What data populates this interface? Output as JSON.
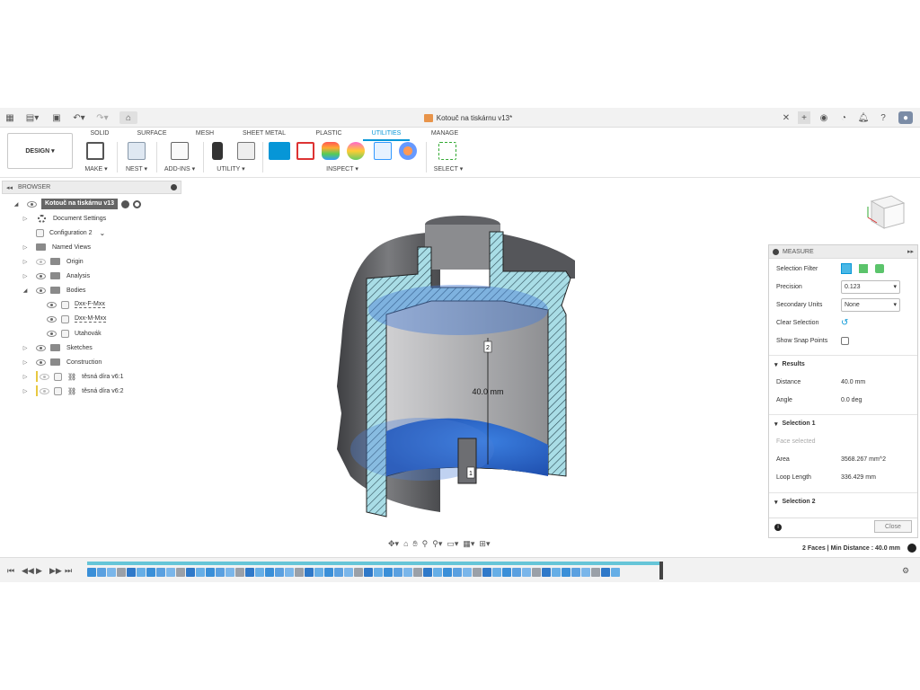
{
  "document": {
    "title": "Kotouč na tiskárnu v13*"
  },
  "ribbon": {
    "design_label": "DESIGN ▾",
    "tabs": [
      {
        "label": "SOLID",
        "active": false
      },
      {
        "label": "SURFACE",
        "active": false
      },
      {
        "label": "MESH",
        "active": false
      },
      {
        "label": "SHEET METAL",
        "active": false
      },
      {
        "label": "PLASTIC",
        "active": false
      },
      {
        "label": "UTILITIES",
        "active": true
      },
      {
        "label": "MANAGE",
        "active": false
      }
    ],
    "groups": {
      "make": "MAKE ▾",
      "nest": "NEST ▾",
      "addins": "ADD-INS ▾",
      "utility": "UTILITY ▾",
      "inspect": "INSPECT ▾",
      "select": "SELECT ▾"
    }
  },
  "browser": {
    "header": "BROWSER",
    "root": "Kotouč na tiskárnu v13",
    "items": [
      {
        "label": "Document Settings"
      },
      {
        "label": "Configuration 2"
      },
      {
        "label": "Named Views"
      },
      {
        "label": "Origin"
      },
      {
        "label": "Analysis"
      },
      {
        "label": "Bodies"
      },
      {
        "label": "Dxx-F-Mxx"
      },
      {
        "label": "Dxx-M-Mxx"
      },
      {
        "label": "Utahovák"
      },
      {
        "label": "Sketches"
      },
      {
        "label": "Construction"
      },
      {
        "label": "těsná díra v6:1"
      },
      {
        "label": "těsná díra v6:2"
      }
    ]
  },
  "viewport": {
    "dimension_label": "40.0 mm",
    "point_1": "1",
    "point_2": "2"
  },
  "measure": {
    "header": "MEASURE",
    "selection_filter": "Selection Filter",
    "precision_label": "Precision",
    "precision_value": "0.123",
    "secondary_units_label": "Secondary Units",
    "secondary_units_value": "None",
    "clear_selection": "Clear Selection",
    "show_snap_points": "Show Snap Points",
    "results_title": "Results",
    "distance_label": "Distance",
    "distance_value": "40.0 mm",
    "angle_label": "Angle",
    "angle_value": "0.0 deg",
    "selection1_title": "Selection 1",
    "face_selected": "Face selected",
    "area_label": "Area",
    "area_value": "3568.267 mm^2",
    "loop_length_label": "Loop Length",
    "loop_length_value": "336.429 mm",
    "selection2_title": "Selection 2",
    "close_label": "Close"
  },
  "status": {
    "text": "2 Faces | Min Distance : 40.0 mm"
  },
  "colors": {
    "accent": "#0696d7",
    "selected_face": "#2f6ecf",
    "section_hatch": "#a9dde6",
    "body_gray": "#5f6063"
  }
}
